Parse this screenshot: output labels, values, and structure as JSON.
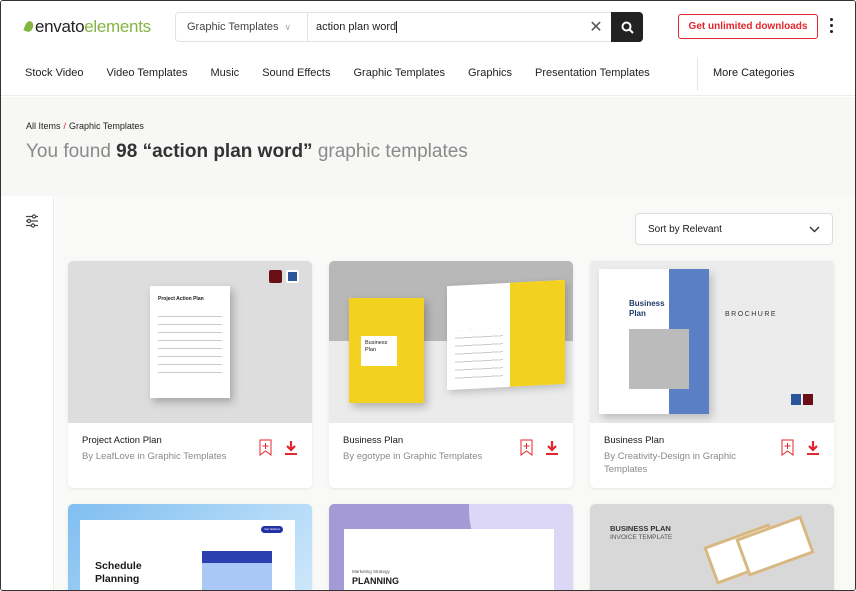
{
  "header": {
    "logo_bold": "envato",
    "logo_light": "elements",
    "search_category": "Graphic Templates",
    "search_query": "action plan word",
    "cta_label": "Get unlimited downloads"
  },
  "nav": {
    "items": [
      "Stock Video",
      "Video Templates",
      "Music",
      "Sound Effects",
      "Graphic Templates",
      "Graphics",
      "Presentation Templates"
    ],
    "more": "More Categories"
  },
  "breadcrumb": {
    "root": "All Items",
    "separator": "/",
    "current": "Graphic Templates"
  },
  "results": {
    "prefix": "You found",
    "count": "98",
    "query": "“action plan word”",
    "suffix": "graphic templates"
  },
  "sort": {
    "label": "Sort by Relevant"
  },
  "colors": {
    "accent": "#e0262e",
    "brand_green": "#82b541"
  },
  "cards": [
    {
      "title": "Project Action Plan",
      "byline": "By LeafLove in Graphic Templates",
      "thumb_text": "Project Action Plan"
    },
    {
      "title": "Business Plan",
      "byline": "By egotype in Graphic Templates",
      "thumb_text": "Business Plan"
    },
    {
      "title": "Business Plan",
      "byline": "By Creativity-Design in Graphic Templates",
      "thumb_text": "Business Plan",
      "thumb_text2": "BROCHURE"
    },
    {
      "thumb_text": "Schedule Planning",
      "thumb_button": "Get Started"
    },
    {
      "thumb_text": "PLANNING",
      "thumb_text2": "Marketing Strategy"
    },
    {
      "thumb_text": "BUSINESS PLAN",
      "thumb_text2": "INVOICE TEMPLATE"
    }
  ]
}
